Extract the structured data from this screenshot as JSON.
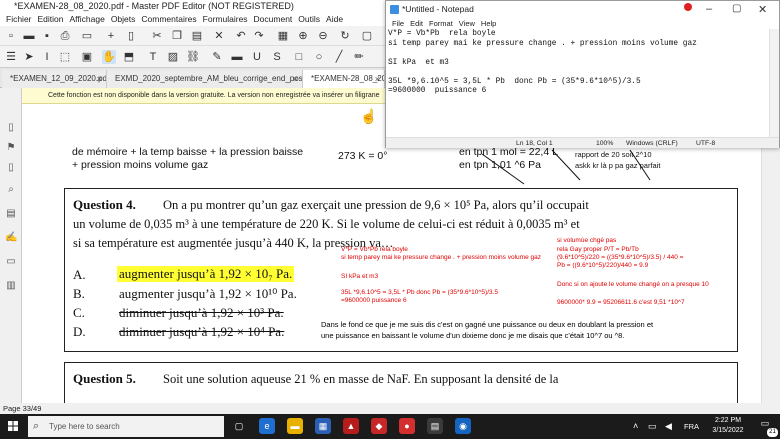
{
  "editor": {
    "title": "*EXAMEN-28_08_2020.pdf - Master PDF Editor (NOT REGISTERED)",
    "menu": [
      "Fichier",
      "Edition",
      "Affichage",
      "Objets",
      "Commentaires",
      "Formulaires",
      "Document",
      "Outils",
      "Aide"
    ],
    "tabs": [
      {
        "label": "*EXAMEN_12_09_2020.pdf"
      },
      {
        "label": "EXMD_2020_septembre_AM_bleu_corrige_end_postdelbe.pdf"
      },
      {
        "label": "*EXAMEN-28_08_2020.pdf"
      }
    ],
    "notice": "Cette fonction est non disponible dans la version gratuite.  La version non enregistrée va insérer un filigrane",
    "status": "Page 33/49"
  },
  "doc": {
    "hand_left_1": "de mémoire + la temp baisse + la pression baisse",
    "hand_left_2": "+ pression moins volume gaz",
    "hand_mid": "273 K = 0°",
    "hand_mid2": "en tpn 1 mol = 22,4 L",
    "hand_mid3": "en tpn 1,01 ^6 Pa",
    "hand_right_1": "rapport de 20 soit 2^10",
    "hand_right_2": "askk kr là p pa gaz parfait",
    "q4_title": "Question 4.",
    "q4_line1": "On a pu montrer qu’un gaz exerçait une pression de 9,6 × 10⁵ Pa, alors qu’il occupait",
    "q4_line2": "un volume de 0,035 m³ à une température de 220 K. Si le volume de celui-ci est réduit à 0,0035 m³ et",
    "q4_line3": "si sa température est augmentée jusqu’à 440 K, la pression va…",
    "answers": [
      {
        "letter": "A.",
        "text": "augmenter jusqu’à 1,92 × 10₇ Pa."
      },
      {
        "letter": "B.",
        "text": "augmenter jusqu’à 1,92 × 10¹⁰ Pa."
      },
      {
        "letter": "C.",
        "text": "diminuer jusqu’à 1,92 × 10³ Pa."
      },
      {
        "letter": "D.",
        "text": "diminuer jusqu’à 1,92 × 10⁴ Pa."
      }
    ],
    "red_mid_1": "V*P = Vb*Pb  rela boyle",
    "red_mid_2": "si temp parey mai ke pressure change . + pression moins volume gaz",
    "red_mid_3": "SI kPa  et m3",
    "red_mid_4": "35L *9,6.10^5 = 3,5L * Pb  donc Pb = (35*9.6*10^5)/3.5",
    "red_mid_5": "=9600000  puissance 6",
    "red_right_1": "si volumùe chgé pas",
    "red_right_2": "rela Gay proper  P/T  = Pb/Tb",
    "red_right_3": "(9.6*10^5)/220 = ((35*9.6*10^5)/3.5) / 440 =",
    "red_right_4": "Pb = ((9.6*10^5)/220)/440 = 9.9",
    "red_right_5": "Donc si on ajoute le volume changé on a presque 10",
    "red_right_6": "9600000* 9.9 = 95206611.6  c'est 9,51 *10^7",
    "note_1": "Dans le fond ce que je me suis dis c'est on gagné une puissance ou deux en doublant la pression et",
    "note_2": "une puissance en baissant le volume d'un dixieme donc je me disais que c'était 10^7 ou ^8.",
    "q5_title": "Question 5.",
    "q5_line1": "Soit une solution aqueuse 21 % en masse de NaF. En supposant la densité de la"
  },
  "notepad": {
    "title": "*Untitled - Notepad",
    "menu": [
      "File",
      "Edit",
      "Format",
      "View",
      "Help"
    ],
    "content": "V*P = Vb*Pb  rela boyle\nsi temp parey mai ke pressure change . + pression moins volume gaz\n\nSI kPa  et m3\n\n35L *9,6.10^5 = 3,5L * Pb  donc Pb = (35*9.6*10^5)/3.5\n=9600000  puissance 6\n",
    "status_pos": "Ln 18, Col 1",
    "status_zoom": "100%",
    "status_eol": "Windows (CRLF)",
    "status_enc": "UTF-8"
  },
  "taskbar": {
    "search_placeholder": "Type here to search",
    "lang": "FRA",
    "time": "2:22 PM",
    "date": "3/15/2022",
    "notif_count": "21"
  },
  "colors": {
    "highlight": "#ffff33",
    "annotation_red": "#e00000",
    "taskbar": "#1b1b1b"
  }
}
